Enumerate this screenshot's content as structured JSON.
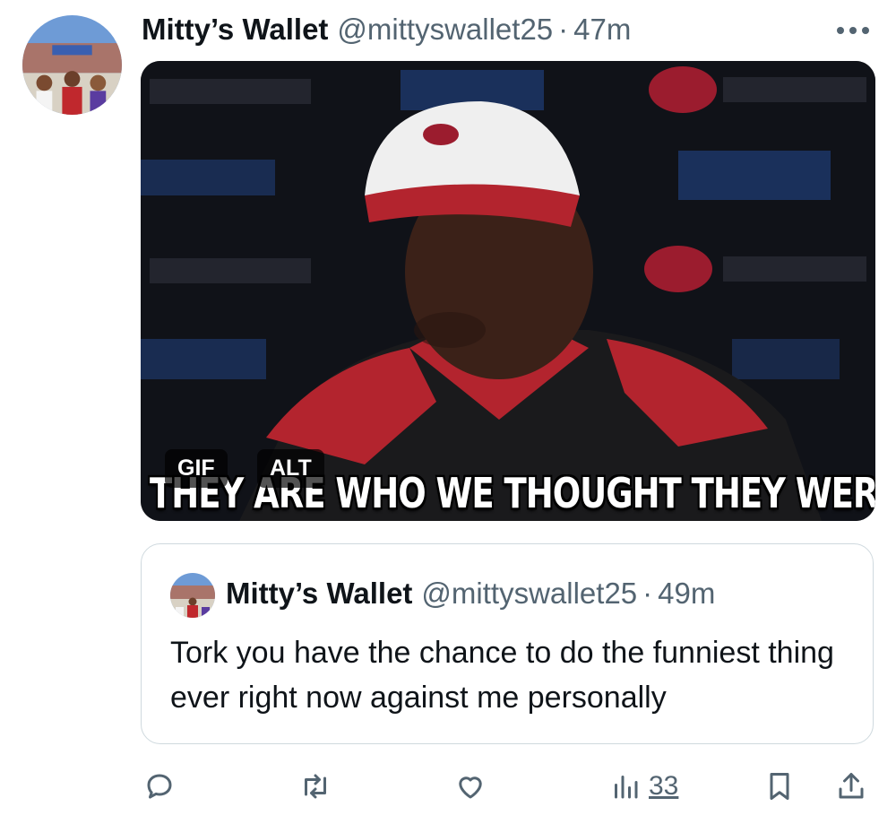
{
  "tweet": {
    "author_name": "Mitty’s Wallet",
    "handle": "@mittyswallet25",
    "separator": "·",
    "time": "47m",
    "media": {
      "caption": "THEY ARE WHO WE THOUGHT THEY WERE!",
      "gif_badge": "GIF",
      "alt_badge": "ALT"
    }
  },
  "quoted_tweet": {
    "author_name": "Mitty’s Wallet",
    "handle": "@mittyswallet25",
    "separator": "·",
    "time": "49m",
    "text": "Tork you have the chance to do the funniest thing ever right now against me personally"
  },
  "actions": {
    "views_count": "33",
    "icons": [
      "reply-icon",
      "retweet-icon",
      "like-icon",
      "views-icon",
      "bookmark-icon",
      "share-icon"
    ]
  },
  "colors": {
    "secondary_text": "#536471",
    "border": "#cfd9de",
    "primary_text": "#0f1419"
  }
}
